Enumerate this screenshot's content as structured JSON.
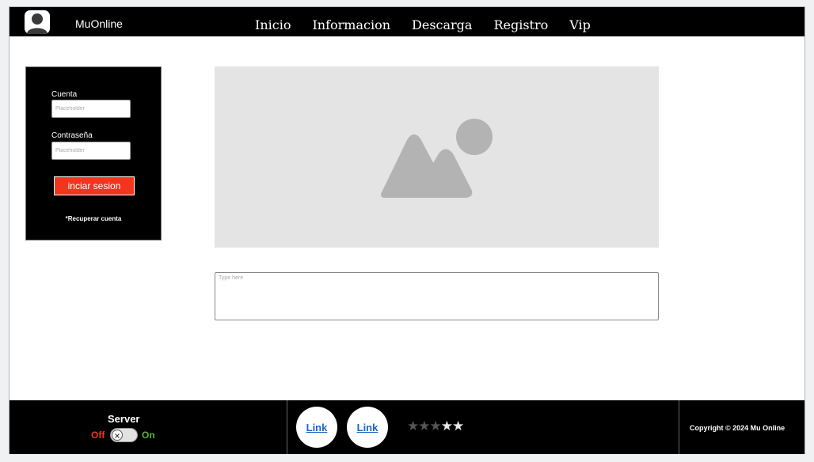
{
  "header": {
    "brand": "MuOnline",
    "avatar_icon": "user-avatar-icon",
    "nav": [
      "Inicio",
      "Informacion",
      "Descarga",
      "Registro",
      "Vip"
    ]
  },
  "login": {
    "account_label": "Cuenta",
    "account_placeholder": "Placeholder",
    "password_label": "Contraseña",
    "password_placeholder": "Placeholder",
    "submit_label": "inciar sesion",
    "recover_label": "*Recuperar cuenta"
  },
  "main": {
    "image_icon": "image-placeholder-icon",
    "textarea_placeholder": "Type here"
  },
  "footer": {
    "server_title": "Server",
    "off_label": "Off",
    "on_label": "On",
    "server_toggle_on": false,
    "links": [
      "Link",
      "Link"
    ],
    "rating": {
      "value": 2,
      "max": 5
    },
    "copyright": "Copyright © 2024 Mu Online"
  },
  "colors": {
    "login_button": "#f1361d",
    "off_label": "#f1361d",
    "on_label": "#5ab334",
    "link": "#1a64c8",
    "bar_background": "#000000",
    "image_placeholder_bg": "#e4e4e4",
    "image_placeholder_shape": "#b3b3b3"
  }
}
